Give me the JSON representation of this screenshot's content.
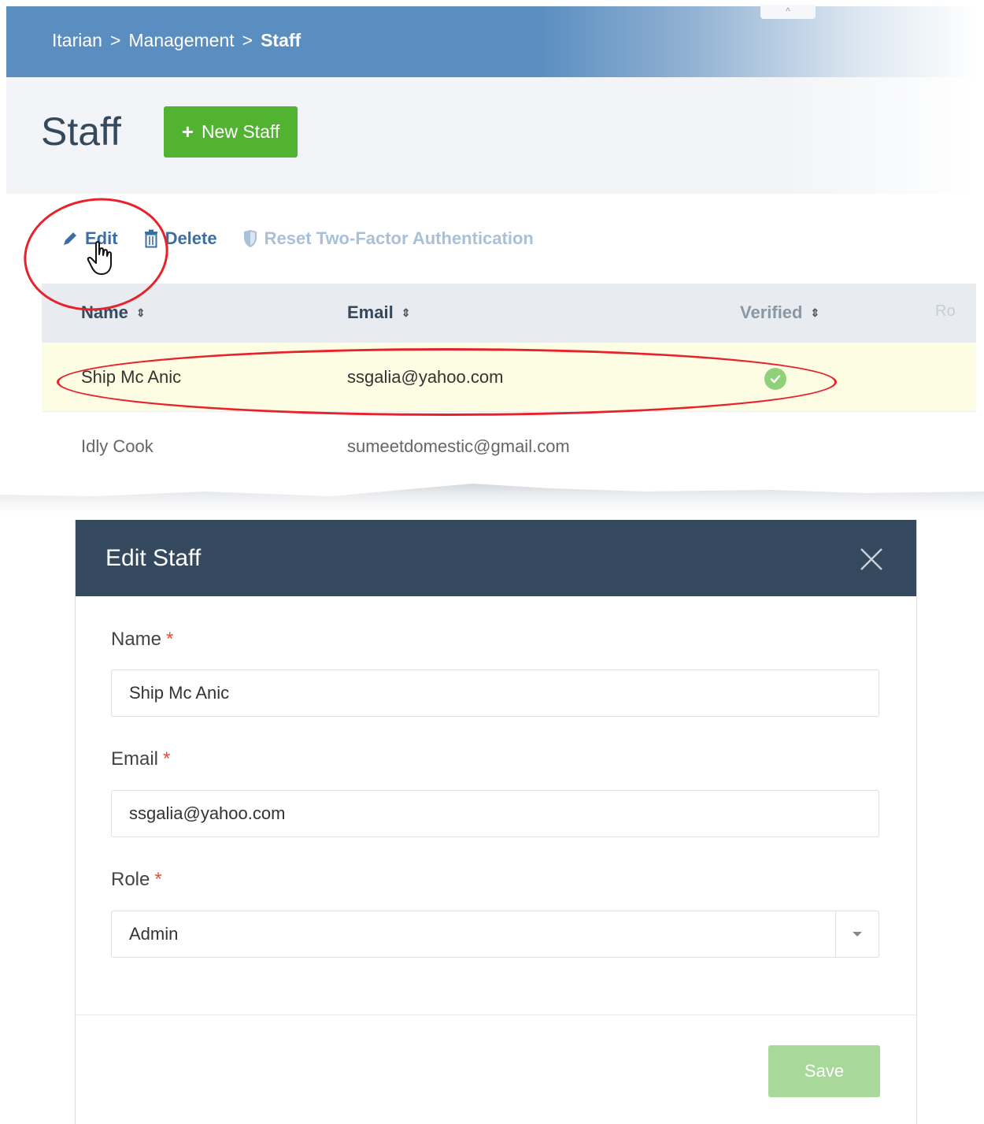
{
  "breadcrumb": {
    "root": "Itarian",
    "section": "Management",
    "current": "Staff",
    "separator": ">"
  },
  "header": {
    "collapse_glyph": "^"
  },
  "page": {
    "title": "Staff",
    "new_button_label": "New Staff",
    "new_button_icon": "plus-icon"
  },
  "actions": [
    {
      "label": "Edit",
      "icon": "pencil-icon"
    },
    {
      "label": "Delete",
      "icon": "trash-icon"
    },
    {
      "label": "Reset Two-Factor Authentication",
      "icon": "shield-icon"
    }
  ],
  "table": {
    "columns": [
      "Name",
      "Email",
      "Verified",
      "Ro"
    ],
    "sort_glyph": "⇕",
    "rows": [
      {
        "name": "Ship Mc Anic",
        "email": "ssgalia@yahoo.com",
        "verified": true,
        "selected": true
      },
      {
        "name": "Idly Cook",
        "email": "sumeetdomestic@gmail.com",
        "verified": false,
        "selected": false
      }
    ]
  },
  "modal": {
    "title": "Edit Staff",
    "required_marker": "*",
    "fields": {
      "name": {
        "label": "Name",
        "value": "Ship Mc Anic"
      },
      "email": {
        "label": "Email",
        "value": "ssgalia@yahoo.com"
      },
      "role": {
        "label": "Role",
        "value": "Admin"
      }
    },
    "save_label": "Save"
  },
  "colors": {
    "header_blue": "#5b8ec0",
    "modal_header": "#34495e",
    "primary_green": "#52b332",
    "save_disabled": "#a8d99a",
    "link_blue": "#3c6ea6",
    "annotation_red": "#e8222a",
    "selected_row": "#fcfde3",
    "required_red": "#e74c3c"
  }
}
